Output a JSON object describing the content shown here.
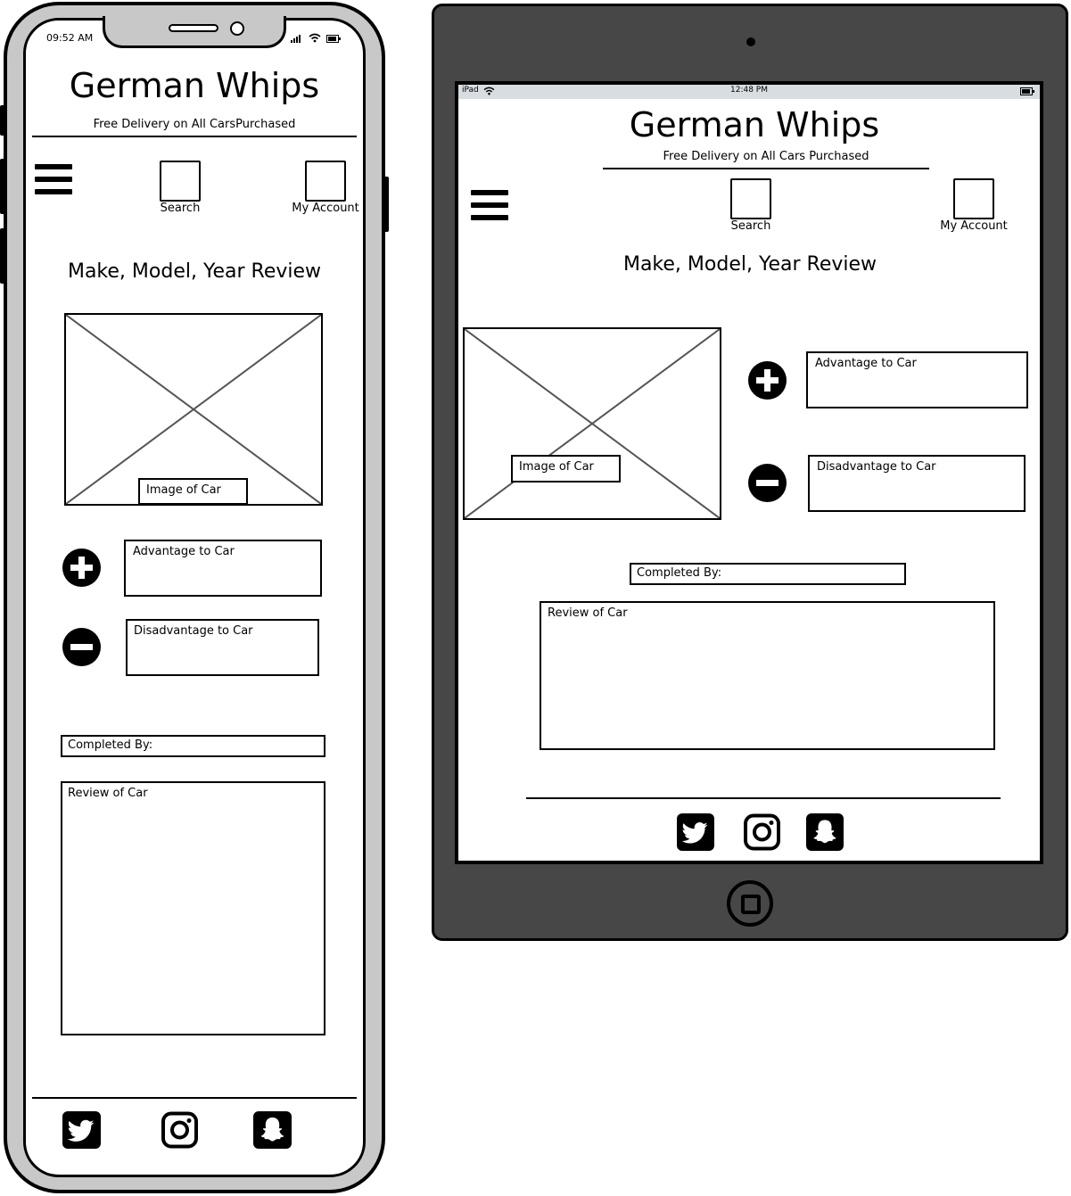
{
  "phone": {
    "status": {
      "time": "09:52 AM"
    },
    "header": {
      "title": "German Whips",
      "subtitle": "Free Delivery on All CarsPurchased"
    },
    "nav": {
      "search_label": "Search",
      "account_label": "My Account",
      "menu_icon": "hamburger-menu-icon"
    },
    "content": {
      "heading": "Make, Model, Year Review",
      "image_label": "Image of Car",
      "advantage_label": "Advantage to Car",
      "disadvantage_label": "Disadvantage to Car",
      "completed_by_label": "Completed By:",
      "review_label": "Review of Car"
    },
    "footer": {
      "icons": [
        "twitter-icon",
        "instagram-icon",
        "snapchat-icon"
      ]
    }
  },
  "tablet": {
    "status": {
      "device": "iPad",
      "time": "12:48 PM"
    },
    "header": {
      "title": "German Whips",
      "subtitle": "Free Delivery on All Cars Purchased"
    },
    "nav": {
      "search_label": "Search",
      "account_label": "My Account",
      "menu_icon": "hamburger-menu-icon"
    },
    "content": {
      "heading": "Make, Model, Year Review",
      "image_label": "Image of Car",
      "advantage_label": "Advantage to Car",
      "disadvantage_label": "Disadvantage to Car",
      "completed_by_label": "Completed By:",
      "review_label": "Review of Car"
    },
    "footer": {
      "icons": [
        "twitter-icon",
        "instagram-icon",
        "snapchat-icon"
      ]
    }
  },
  "colors": {
    "device_frame_phone": "#c8c8c8",
    "device_frame_tablet": "#474747",
    "status_bar_tablet": "#d8dde2"
  }
}
